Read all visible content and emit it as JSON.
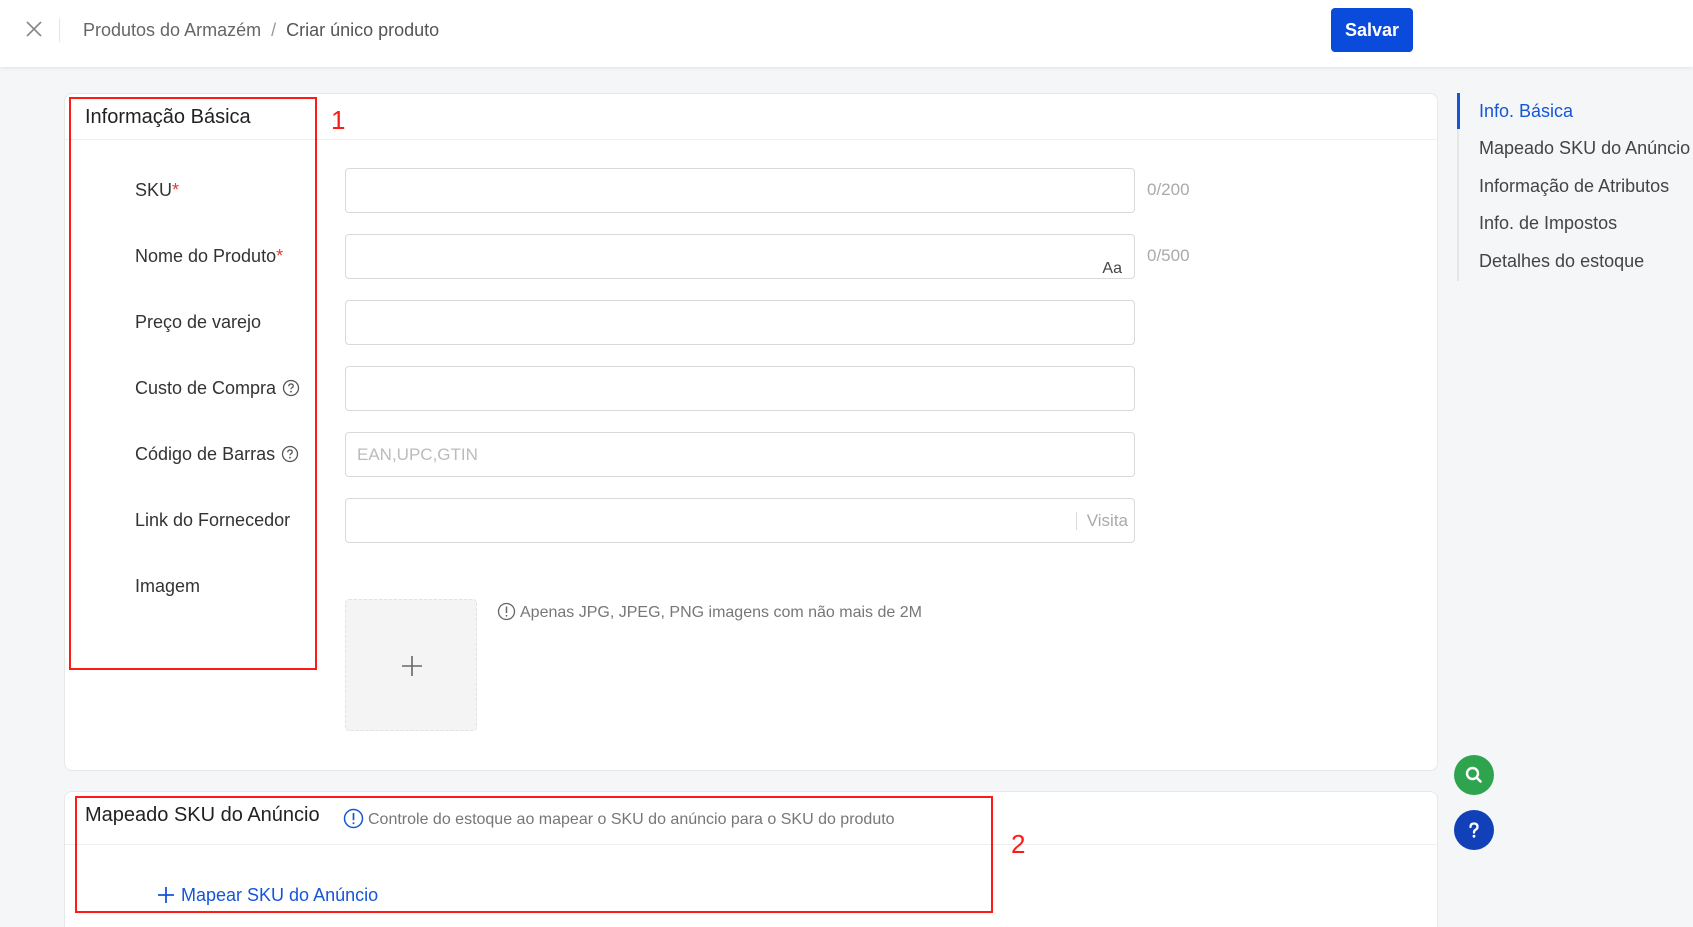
{
  "header": {
    "breadcrumb_parent": "Produtos do Armazém",
    "breadcrumb_sep": "/",
    "breadcrumb_current": "Criar único produto",
    "save_label": "Salvar"
  },
  "basic_info": {
    "title": "Informação Básica",
    "fields": {
      "sku": {
        "label": "SKU",
        "required": "*",
        "value": "",
        "counter": "0/200"
      },
      "product_name": {
        "label": "Nome do Produto",
        "required": "*",
        "value": "",
        "counter": "0/500",
        "case_icon": "Aa"
      },
      "retail_price": {
        "label": "Preço de varejo",
        "value": ""
      },
      "purchase_cost": {
        "label": "Custo de Compra",
        "value": ""
      },
      "barcode": {
        "label": "Código de Barras",
        "placeholder": "EAN,UPC,GTIN",
        "value": ""
      },
      "supplier_link": {
        "label": "Link do Fornecedor",
        "value": "",
        "visit_label": "Visita"
      },
      "image": {
        "label": "Imagem",
        "hint": "Apenas JPG, JPEG, PNG imagens com não mais de 2M"
      }
    }
  },
  "sku_mapping": {
    "title": "Mapeado SKU do Anúncio",
    "note": "Controle do estoque ao mapear o SKU do anúncio para o SKU do produto",
    "add_label": "Mapear SKU do Anúncio"
  },
  "annotations": [
    "1",
    "2"
  ],
  "toc": {
    "items": [
      "Info. Básica",
      "Mapeado SKU do Anúncio",
      "Informação de Atributos",
      "Info. de Impostos",
      "Detalhes do estoque"
    ],
    "active_index": 0
  },
  "icons": {
    "close": "close-icon",
    "help": "question-circle-icon",
    "info": "info-circle-icon",
    "plus": "plus-icon",
    "search": "search-icon",
    "question": "question-icon"
  },
  "colors": {
    "primary": "#0a4bdc",
    "link": "#1656d6",
    "annotation": "#ff1a1a",
    "search_fab": "#2fa44f",
    "help_fab": "#1140b8"
  }
}
